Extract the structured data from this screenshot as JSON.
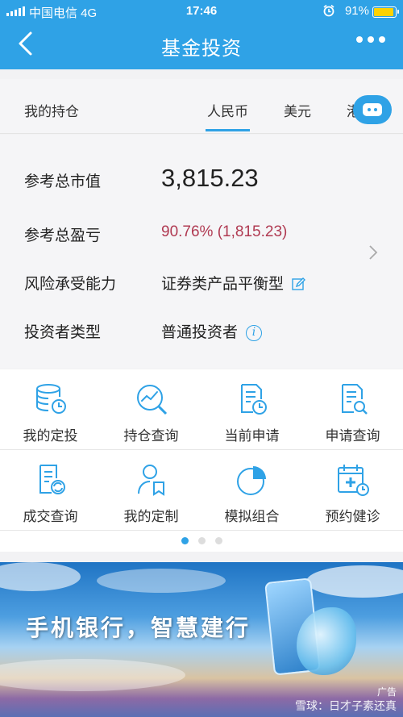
{
  "status_bar": {
    "carrier": "中国电信  4G",
    "time": "17:46",
    "alarm_icon": "alarm-clock-icon",
    "battery": "91%",
    "battery_level": 0.91
  },
  "nav": {
    "title": "基金投资",
    "back_icon": "chevron-left-icon",
    "more_icon": "more-dots-icon"
  },
  "tabs": {
    "section_label": "我的持仓",
    "items": [
      "人民币",
      "美元",
      "港"
    ],
    "active": "人民币"
  },
  "assistant_icon": "robot-icon",
  "summary": {
    "rows": [
      {
        "label": "参考总市值",
        "value": "3,815.23"
      },
      {
        "label": "参考总盈亏",
        "value": "90.76% (1,815.23)"
      },
      {
        "label": "风险承受能力",
        "value": "证券类产品平衡型"
      },
      {
        "label": "投资者类型",
        "value": "普通投资者"
      }
    ],
    "profit_color": "#b03a52"
  },
  "menu": {
    "row1": [
      {
        "label": "我的定投",
        "icon": "database-clock-icon"
      },
      {
        "label": "持仓查询",
        "icon": "chart-magnifier-icon"
      },
      {
        "label": "当前申请",
        "icon": "document-clock-icon"
      },
      {
        "label": "申请查询",
        "icon": "document-search-icon"
      }
    ],
    "row2": [
      {
        "label": "成交查询",
        "icon": "document-refresh-icon"
      },
      {
        "label": "我的定制",
        "icon": "user-bookmark-icon"
      },
      {
        "label": "模拟组合",
        "icon": "pie-chart-icon"
      },
      {
        "label": "预约健诊",
        "icon": "calendar-plus-icon"
      }
    ],
    "page_index": 1,
    "page_count": 3
  },
  "banner": {
    "headline": "手机银行，智慧建行",
    "ad_tag": "广告",
    "watermark": "雪球：日才子素还真"
  },
  "accent_color": "#2fa2e6"
}
